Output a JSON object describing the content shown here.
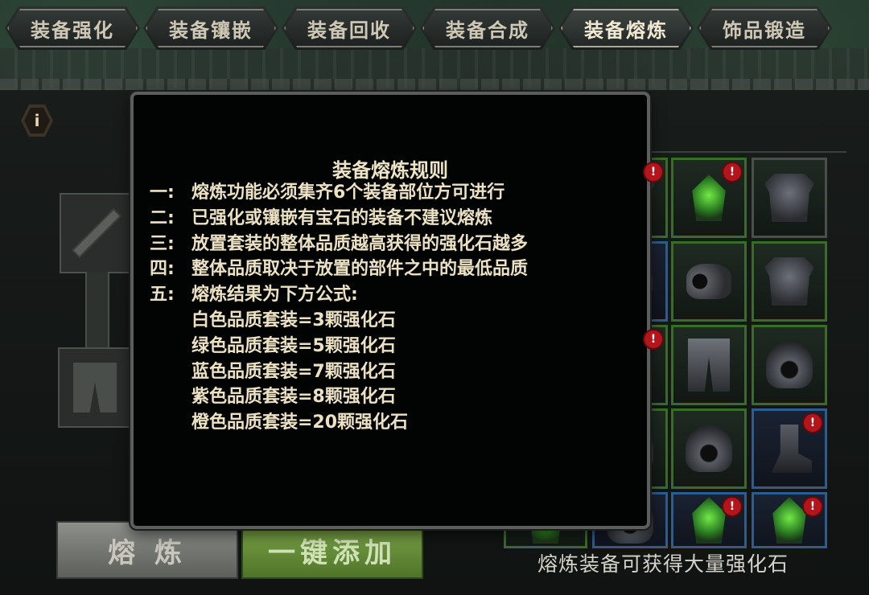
{
  "tabs": [
    {
      "label": "装备强化",
      "active": false
    },
    {
      "label": "装备镶嵌",
      "active": false
    },
    {
      "label": "装备回收",
      "active": false
    },
    {
      "label": "装备合成",
      "active": false
    },
    {
      "label": "装备熔炼",
      "active": true
    },
    {
      "label": "饰品锻造",
      "active": false
    }
  ],
  "popup": {
    "title": "装备熔炼规则",
    "rules": [
      {
        "num": "一:",
        "text": "熔炼功能必须集齐6个装备部位方可进行"
      },
      {
        "num": "二:",
        "text": "已强化或镶嵌有宝石的装备不建议熔炼"
      },
      {
        "num": "三:",
        "text": "放置套装的整体品质越高获得的强化石越多"
      },
      {
        "num": "四:",
        "text": "整体品质取决于放置的部件之中的最低品质"
      },
      {
        "num": "五:",
        "text": "熔炼结果为下方公式:"
      }
    ],
    "formulas": [
      "白色品质套装=3颗强化石",
      "绿色品质套装=5颗强化石",
      "蓝色品质套装=7颗强化石",
      "紫色品质套装=8颗强化石",
      "橙色品质套装=20颗强化石"
    ]
  },
  "buttons": {
    "smelt": "熔 炼",
    "auto_add": "一键添加"
  },
  "hint": "熔炼装备可获得大量强化石",
  "inventory": {
    "warning_badge": "!",
    "colors": {
      "green_border": "#3b6b2a",
      "blue_border": "#2f5b8d",
      "warning": "#b3151b"
    }
  }
}
